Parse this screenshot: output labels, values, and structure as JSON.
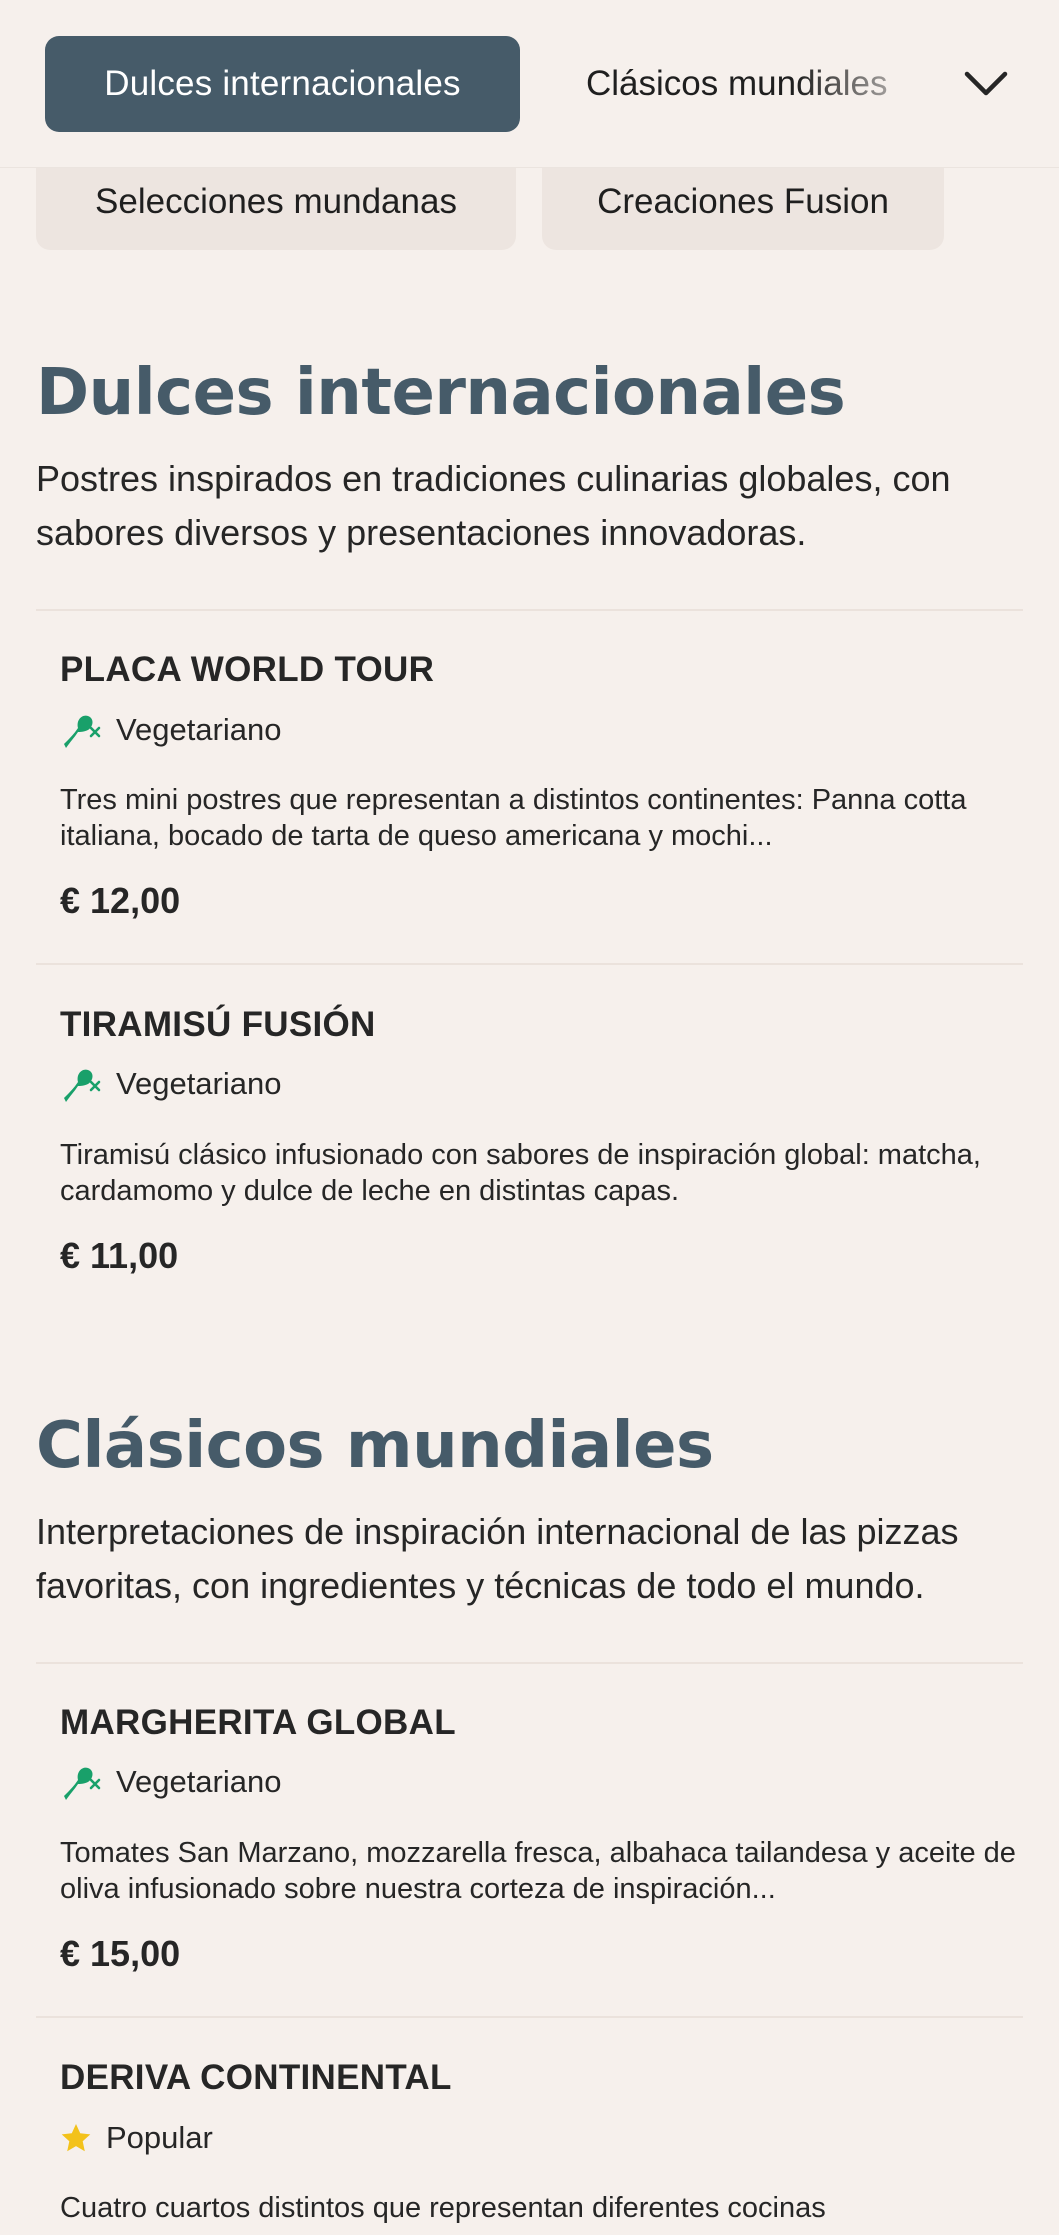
{
  "nav": {
    "active_tab": "Dulces internacionales",
    "next_tab": "Clásicos mundiales",
    "chips": [
      "Selecciones mundanas",
      "Creaciones Fusion"
    ],
    "expand_icon": "chevron-down-icon"
  },
  "colors": {
    "accent": "#465b69",
    "background": "#f6f0ec",
    "chip_bg": "#ede5e0",
    "veg_green": "#19a06a",
    "star_yellow": "#f3c21b"
  },
  "sections": [
    {
      "title": "Dulces internacionales",
      "description": "Postres inspirados en tradiciones culinarias globales, con sabores diversos y presentaciones innovadoras.",
      "items": [
        {
          "name": "PLACA WORLD TOUR",
          "tag": "Vegetariano",
          "tag_icon": "vegetarian-icon",
          "description": "Tres mini postres que representan a distintos continentes: Panna cotta italiana, bocado de tarta de queso americana y mochi...",
          "price": "€ 12,00"
        },
        {
          "name": "TIRAMISÚ FUSIÓN",
          "tag": "Vegetariano",
          "tag_icon": "vegetarian-icon",
          "description": "Tiramisú clásico infusionado con sabores de inspiración global: matcha, cardamomo y dulce de leche en distintas capas.",
          "price": "€ 11,00"
        }
      ]
    },
    {
      "title": "Clásicos mundiales",
      "description": "Interpretaciones de inspiración internacional de las pizzas favoritas, con ingredientes y técnicas de todo el mundo.",
      "items": [
        {
          "name": "MARGHERITA GLOBAL",
          "tag": "Vegetariano",
          "tag_icon": "vegetarian-icon",
          "description": "Tomates San Marzano, mozzarella fresca, albahaca tailandesa y aceite de oliva infusionado sobre nuestra corteza de inspiración...",
          "price": "€ 15,00"
        },
        {
          "name": "DERIVA CONTINENTAL",
          "tag": "Popular",
          "tag_icon": "star-icon",
          "description": "Cuatro cuartos distintos que representan diferentes cocinas"
        }
      ]
    }
  ]
}
